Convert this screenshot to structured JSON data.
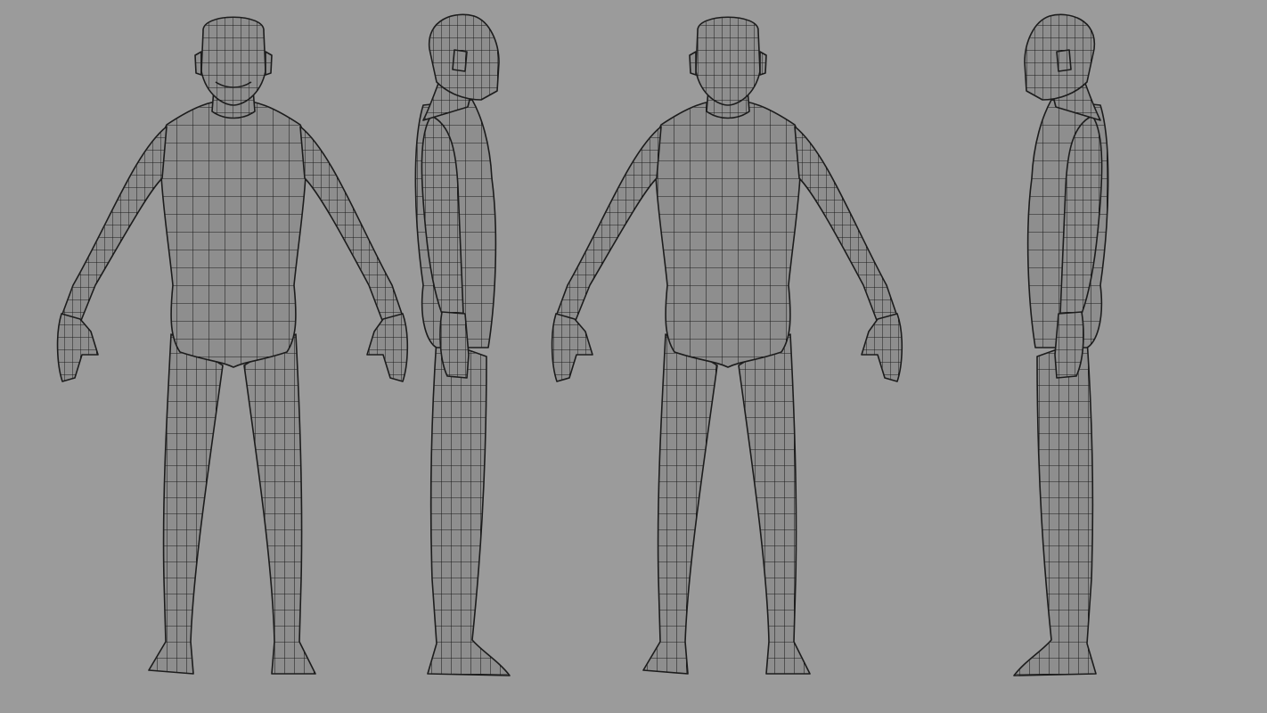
{
  "scene": {
    "background_color": "#9b9b9b",
    "body_fill_color": "#8e8e8e",
    "wire_color": "#1c1c1c",
    "views": [
      {
        "id": "front",
        "name": "front-view"
      },
      {
        "id": "side-right",
        "name": "side-view-right"
      },
      {
        "id": "back",
        "name": "back-view"
      },
      {
        "id": "side-left",
        "name": "side-view-left"
      }
    ]
  }
}
